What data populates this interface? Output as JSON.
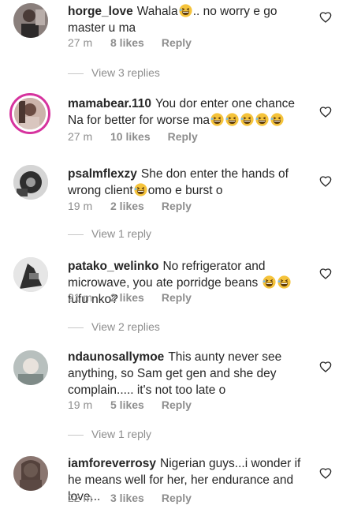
{
  "comments": [
    {
      "username": "horge_love",
      "text_pre": "Wahala",
      "emoji_count": 1,
      "text_post": ".. no worry e go master u ma",
      "time": "27 m",
      "likes": "8 likes",
      "reply": "Reply",
      "avatar_color": "#7b6a6a"
    },
    {
      "username": "mamabear.110",
      "text_pre": "You dor enter one chance Na for better for worse ma",
      "emoji_count": 5,
      "text_post": "",
      "time": "27 m",
      "likes": "10 likes",
      "reply": "Reply",
      "avatar_color": "#b99a8f"
    },
    {
      "username": "psalmflexzy",
      "text_pre": "She don enter the hands of wrong client",
      "emoji_count": 1,
      "text_post": "omo e burst o",
      "time": "19 m",
      "likes": "2 likes",
      "reply": "Reply",
      "avatar_color": "#3a3a3a"
    },
    {
      "username": "patako_welinko",
      "text_pre": "No refrigerator and microwave, you ate porridge beans",
      "emoji_count": 2,
      "text_post": " fufu nko?",
      "time": "21 m",
      "likes": "2 likes",
      "reply": "Reply",
      "avatar_color": "#555555"
    },
    {
      "username": "ndaunosallymoe",
      "text_pre": "This aunty never see anything, so Sam get gen and she dey complain..... it's not too late o",
      "emoji_count": 0,
      "text_post": "",
      "time": "19 m",
      "likes": "5 likes",
      "reply": "Reply",
      "avatar_color": "#a8b0ae"
    },
    {
      "username": "iamforeverrosy",
      "text_pre": "Nigerian guys...i wonder if he means well for her, her endurance and love...",
      "emoji_count": 0,
      "text_post": "",
      "time": "22 m",
      "likes": "3 likes",
      "reply": "Reply",
      "avatar_color": "#6e5a52"
    }
  ],
  "view_replies": [
    "View 3 replies",
    "View 1 reply",
    "View 2 replies",
    "View 1 reply"
  ],
  "colors": {
    "text": "#262626",
    "secondary": "#8e8e8e",
    "story_ring": "#d6339e"
  },
  "icons": {
    "heart": "heart-outline-icon",
    "emoji": "grinning-squinting-face-emoji"
  }
}
